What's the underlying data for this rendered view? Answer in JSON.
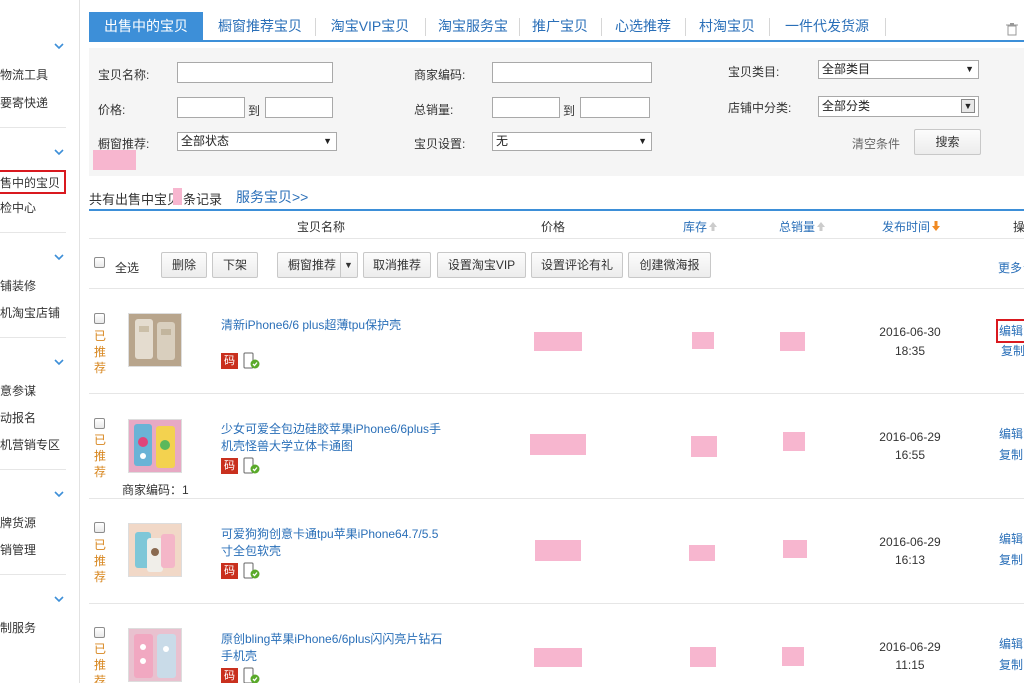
{
  "sidebar": {
    "items": [
      "物流工具",
      "要寄快递",
      "出售中的宝贝",
      "检中心",
      "铺装修",
      "机淘宝店铺",
      "意参谋",
      "动报名",
      "机营销专区",
      "牌货源",
      "销管理",
      "制服务"
    ]
  },
  "tabs": [
    "出售中的宝贝",
    "橱窗推荐宝贝",
    "淘宝VIP宝贝",
    "淘宝服务宝",
    "推广宝贝",
    "心选推荐",
    "村淘宝贝",
    "一件代发货源"
  ],
  "filter": {
    "name_label": "宝贝名称:",
    "code_label": "商家编码:",
    "category_label": "宝贝类目:",
    "category_value": "全部类目",
    "price_label": "价格:",
    "to1": "到",
    "sales_label": "总销量:",
    "to2": "到",
    "shop_cat_label": "店铺中分类:",
    "shop_cat_value": "全部分类",
    "window_label": "橱窗推荐:",
    "window_value": "全部状态",
    "setting_label": "宝贝设置:",
    "setting_value": "无",
    "clear_label": "清空条件",
    "search_label": "搜索"
  },
  "summary": {
    "prefix": "共有出售中宝贝",
    "suffix": "条记录",
    "service_link": "服务宝贝>>"
  },
  "header": {
    "name": "宝贝名称",
    "price": "价格",
    "stock": "库存",
    "sales": "总销量",
    "publish": "发布时间",
    "ops": "操"
  },
  "toolbar": {
    "select_all": "全选",
    "delete": "删除",
    "unlist": "下架",
    "window_recommend": "橱窗推荐",
    "cancel_recommend": "取消推荐",
    "set_vip": "设置淘宝VIP",
    "set_review": "设置评论有礼",
    "create_poster": "创建微海报",
    "more": "更多"
  },
  "rows": [
    {
      "status": "已推荐",
      "title": "清新iPhone6/6 plus超薄tpu保护壳",
      "badge": "码",
      "merchant_code": "",
      "date": "2016-06-30",
      "time": "18:35",
      "edit": "编辑",
      "copy": "复制"
    },
    {
      "status": "已推荐",
      "title": "少女可爱全包边硅胶苹果iPhone6/6plus手机壳怪兽大学立体卡通图",
      "badge": "码",
      "merchant_code": "商家编码：1",
      "date": "2016-06-29",
      "time": "16:55",
      "edit": "编辑",
      "copy": "复制"
    },
    {
      "status": "已推荐",
      "title": "可爱狗狗创意卡通tpu苹果iPhone64.7/5.5寸全包软壳",
      "badge": "码",
      "merchant_code": "",
      "date": "2016-06-29",
      "time": "16:13",
      "edit": "编辑",
      "copy": "复制"
    },
    {
      "status": "已推荐",
      "title": "原创bling苹果iPhone6/6plus闪闪亮片钻石手机壳",
      "badge": "码",
      "merchant_code": "",
      "date": "2016-06-29",
      "time": "11:15",
      "edit": "编辑",
      "copy": "复制"
    }
  ],
  "colors": {
    "accent": "#3d8fd8",
    "link": "#2a6fb8",
    "status": "#d88720",
    "highlight": "#d9191f",
    "redact": "#f7b6cf"
  }
}
